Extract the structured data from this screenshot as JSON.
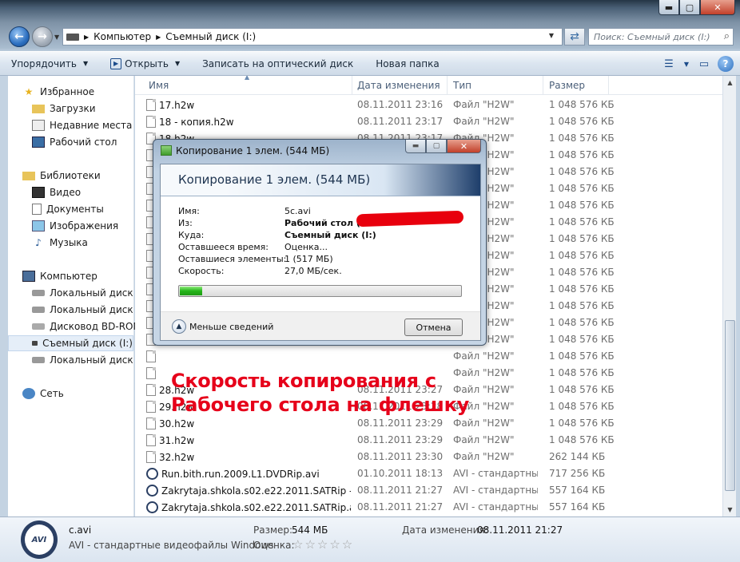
{
  "window": {
    "min": "▬",
    "max": "▢",
    "close": "✕"
  },
  "address": {
    "crumbs": [
      "Компьютер",
      "Съемный диск (I:)"
    ],
    "search_placeholder": "Поиск: Съемный диск (I:)"
  },
  "toolbar": {
    "organize": "Упорядочить",
    "open": "Открыть",
    "burn": "Записать на оптический диск",
    "new_folder": "Новая папка"
  },
  "sidebar": {
    "favorites": "Избранное",
    "fav_items": [
      "Загрузки",
      "Недавние места",
      "Рабочий стол"
    ],
    "libraries": "Библиотеки",
    "lib_items": [
      "Видео",
      "Документы",
      "Изображения",
      "Музыка"
    ],
    "computer": "Компьютер",
    "comp_items": [
      "Локальный диск (C",
      "Локальный диск (D",
      "Дисковод BD-ROM",
      "Съемный диск (I:)",
      "Локальный диск (Z"
    ],
    "network": "Сеть"
  },
  "columns": {
    "name": "Имя",
    "date": "Дата изменения",
    "type": "Тип",
    "size": "Размер"
  },
  "files_top": [
    {
      "name": "17.h2w",
      "date": "08.11.2011 23:16",
      "type": "Файл \"H2W\"",
      "size": "1 048 576 КБ"
    },
    {
      "name": "18 - копия.h2w",
      "date": "08.11.2011 23:17",
      "type": "Файл \"H2W\"",
      "size": "1 048 576 КБ"
    },
    {
      "name": "18.h2w",
      "date": "08.11.2011 23:17",
      "type": "Файл \"H2W\"",
      "size": "1 048 576 КБ"
    }
  ],
  "files_hidden": [
    {
      "type": "Файл \"H2W\"",
      "size": "1 048 576 КБ"
    },
    {
      "type": "Файл \"H2W\"",
      "size": "1 048 576 КБ"
    },
    {
      "type": "Файл \"H2W\"",
      "size": "1 048 576 КБ"
    },
    {
      "type": "Файл \"H2W\"",
      "size": "1 048 576 КБ"
    },
    {
      "type": "Файл \"H2W\"",
      "size": "1 048 576 КБ"
    },
    {
      "type": "Файл \"H2W\"",
      "size": "1 048 576 КБ"
    },
    {
      "type": "Файл \"H2W\"",
      "size": "1 048 576 КБ"
    },
    {
      "type": "Файл \"H2W\"",
      "size": "1 048 576 КБ"
    },
    {
      "type": "Файл \"H2W\"",
      "size": "1 048 576 КБ"
    },
    {
      "type": "Файл \"H2W\"",
      "size": "1 048 576 КБ"
    },
    {
      "type": "Файл \"H2W\"",
      "size": "1 048 576 КБ"
    },
    {
      "type": "Файл \"H2W\"",
      "size": "1 048 576 КБ"
    },
    {
      "type": "Файл \"H2W\"",
      "size": "1 048 576 КБ"
    },
    {
      "type": "Файл \"H2W\"",
      "size": "1 048 576 КБ"
    }
  ],
  "files_bottom": [
    {
      "name": "28.h2w",
      "date": "08.11.2011 23:27",
      "type": "Файл \"H2W\"",
      "size": "1 048 576 КБ",
      "icon": "file"
    },
    {
      "name": "29.h2w",
      "date": "08.11.2011 23:28",
      "type": "Файл \"H2W\"",
      "size": "1 048 576 КБ",
      "icon": "file"
    },
    {
      "name": "30.h2w",
      "date": "08.11.2011 23:29",
      "type": "Файл \"H2W\"",
      "size": "1 048 576 КБ",
      "icon": "file"
    },
    {
      "name": "31.h2w",
      "date": "08.11.2011 23:29",
      "type": "Файл \"H2W\"",
      "size": "1 048 576 КБ",
      "icon": "file"
    },
    {
      "name": "32.h2w",
      "date": "08.11.2011 23:30",
      "type": "Файл \"H2W\"",
      "size": "262 144 КБ",
      "icon": "file"
    },
    {
      "name": "Run.bith.run.2009.L1.DVDRip.avi",
      "date": "01.10.2011 18:13",
      "type": "AVI - стандартны...",
      "size": "717 256 КБ",
      "icon": "avi"
    },
    {
      "name": "Zakrytaja.shkola.s02.e22.2011.SATRip - к...",
      "date": "08.11.2011 21:27",
      "type": "AVI - стандартны...",
      "size": "557 164 КБ",
      "icon": "avi"
    },
    {
      "name": "Zakrytaja.shkola.s02.e22.2011.SATRip.avi",
      "date": "08.11.2011 21:27",
      "type": "AVI - стандартны...",
      "size": "557 164 КБ",
      "icon": "avi"
    },
    {
      "name": "Zakrytaja.shkola.s02.e22.2011.SATRip - к...",
      "date": "08.11.2011 21:27",
      "type": "AVI - стандартны...",
      "size": "557 164 КБ",
      "icon": "avi"
    },
    {
      "name": "c.avi",
      "date": "08.11.2011 21:27",
      "type": "AVI - стандартны...",
      "size": "557 164 КБ",
      "icon": "avi"
    }
  ],
  "copy_dialog": {
    "title": "Копирование 1 элем. (544 МБ)",
    "header": "Копирование 1 элем. (544 МБ)",
    "labels": {
      "name": "Имя:",
      "from": "Из:",
      "to": "Куда:",
      "time_left": "Оставшееся время:",
      "items_left": "Оставшиеся элементы:",
      "speed": "Скорость:"
    },
    "values": {
      "name": "5c.avi",
      "from": "Рабочий стол (C",
      "to": "Съемный диск (I:)",
      "time_left": "Оценка...",
      "items_left": "1 (517 МБ)",
      "speed": "27,0 МБ/сек."
    },
    "progress": 0.08,
    "less_details": "Меньше сведений",
    "cancel": "Отмена"
  },
  "annotation": {
    "line1": "Скорость копирования с",
    "line2": "Рабочего стола на флешку"
  },
  "details": {
    "icon_text": "AVI",
    "name": "c.avi",
    "type": "AVI - стандартные видеофайлы Windows",
    "size_label": "Размер:",
    "size_value": "544 МБ",
    "date_label": "Дата изменения:",
    "date_value": "08.11.2011 21:27",
    "rating_label": "Оценка:",
    "stars": "☆☆☆☆☆"
  },
  "colors": {
    "annotation": "#e6001a",
    "redaction": "#e8000d",
    "progress": "#25b51a"
  }
}
